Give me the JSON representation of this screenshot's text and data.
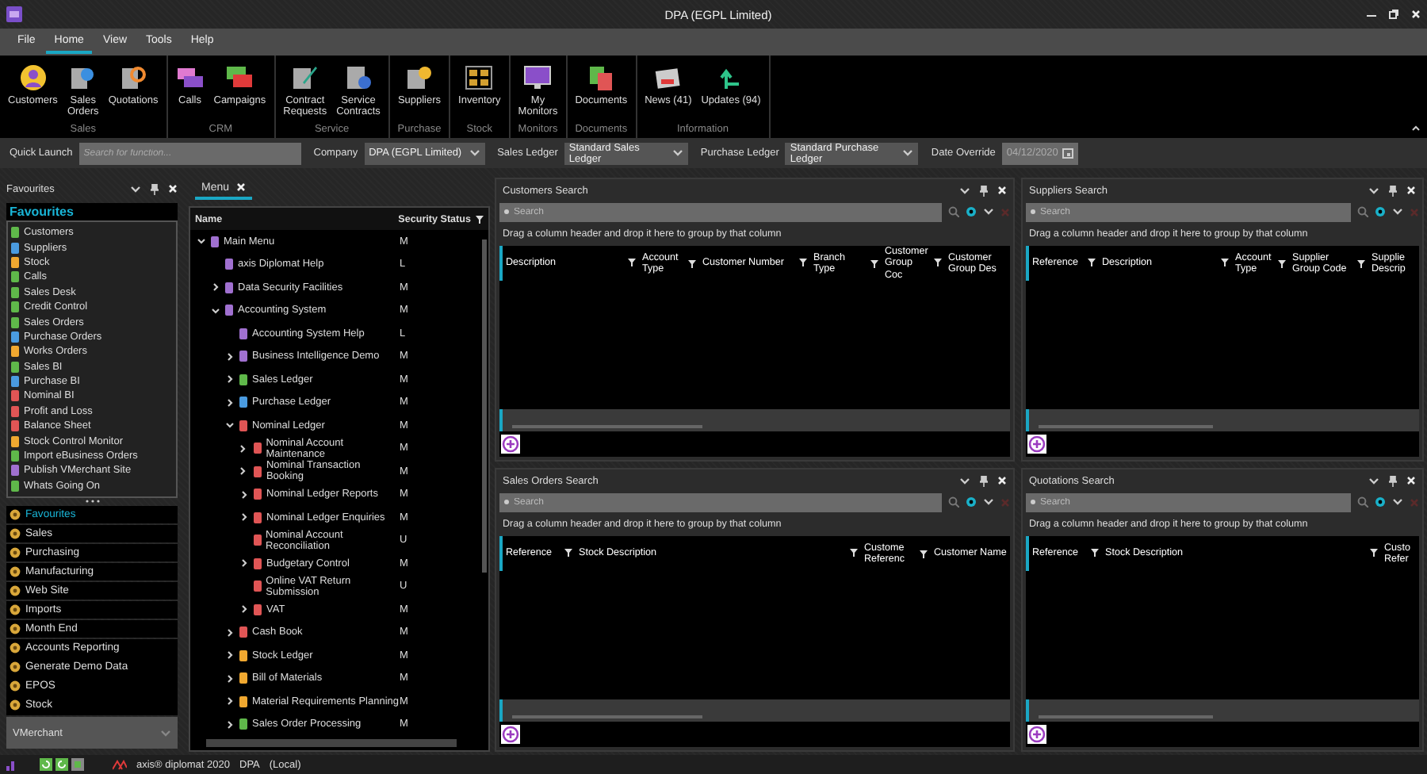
{
  "window": {
    "title": "DPA (EGPL Limited)"
  },
  "menu_bar": [
    {
      "label": "File",
      "selected": false
    },
    {
      "label": "Home",
      "selected": true
    },
    {
      "label": "View",
      "selected": false
    },
    {
      "label": "Tools",
      "selected": false
    },
    {
      "label": "Help",
      "selected": false
    }
  ],
  "ribbon": [
    {
      "label": "Sales",
      "buttons": [
        {
          "lines": [
            "Customers"
          ]
        },
        {
          "lines": [
            "Sales",
            "Orders"
          ]
        },
        {
          "lines": [
            "Quotations"
          ]
        }
      ]
    },
    {
      "label": "CRM",
      "buttons": [
        {
          "lines": [
            "Calls"
          ]
        },
        {
          "lines": [
            "Campaigns"
          ]
        }
      ]
    },
    {
      "label": "Service",
      "buttons": [
        {
          "lines": [
            "Contract",
            "Requests"
          ]
        },
        {
          "lines": [
            "Service",
            "Contracts"
          ]
        }
      ]
    },
    {
      "label": "Purchase",
      "buttons": [
        {
          "lines": [
            "Suppliers"
          ]
        }
      ]
    },
    {
      "label": "Stock",
      "buttons": [
        {
          "lines": [
            "Inventory"
          ]
        }
      ]
    },
    {
      "label": "Monitors",
      "buttons": [
        {
          "lines": [
            "My",
            "Monitors"
          ]
        }
      ]
    },
    {
      "label": "Documents",
      "buttons": [
        {
          "lines": [
            "Documents"
          ]
        }
      ]
    },
    {
      "label": "Information",
      "buttons": [
        {
          "lines": [
            "News (41)"
          ]
        },
        {
          "lines": [
            "Updates (94)"
          ]
        }
      ]
    }
  ],
  "quick_launch": {
    "label": "Quick Launch",
    "placeholder": "Search for function...",
    "selectors": [
      {
        "label": "Company",
        "value": "DPA (EGPL Limited)"
      },
      {
        "label": "Sales Ledger",
        "value": "Standard Sales Ledger"
      },
      {
        "label": "Purchase Ledger",
        "value": "Standard Purchase Ledger"
      }
    ],
    "date": {
      "label": "Date Override",
      "value": "04/12/2020",
      "disabled": true
    }
  },
  "favourites": {
    "title": "Favourites",
    "heading": "Favourites",
    "items": [
      {
        "label": "Customers",
        "color": "#5fb84a"
      },
      {
        "label": "Suppliers",
        "color": "#4a9be0"
      },
      {
        "label": "Stock",
        "color": "#f0a830"
      },
      {
        "label": "Calls",
        "color": "#5fb84a"
      },
      {
        "label": "Sales Desk",
        "color": "#5fb84a"
      },
      {
        "label": "Credit Control",
        "color": "#5fb84a"
      },
      {
        "label": "Sales Orders",
        "color": "#5fb84a"
      },
      {
        "label": "Purchase Orders",
        "color": "#4a9be0"
      },
      {
        "label": "Works Orders",
        "color": "#f0a830"
      },
      {
        "label": "Sales BI",
        "color": "#5fb84a"
      },
      {
        "label": "Purchase BI",
        "color": "#4a9be0"
      },
      {
        "label": "Nominal BI",
        "color": "#e05555"
      },
      {
        "label": "Profit and Loss",
        "color": "#e05555"
      },
      {
        "label": "Balance Sheet",
        "color": "#e05555"
      },
      {
        "label": "Stock Control Monitor",
        "color": "#f0a830"
      },
      {
        "label": "Import eBusiness Orders",
        "color": "#5fb84a"
      },
      {
        "label": "Publish VMerchant Site",
        "color": "#a070d0"
      },
      {
        "label": "Whats Going On",
        "color": "#5fb84a"
      }
    ],
    "groups": [
      {
        "label": "Favourites",
        "selected": true
      },
      {
        "label": "Sales",
        "selected": false
      },
      {
        "label": "Purchasing",
        "selected": false
      },
      {
        "label": "Manufacturing",
        "selected": false
      },
      {
        "label": "Web Site",
        "selected": false
      },
      {
        "label": "Imports",
        "selected": false
      },
      {
        "label": "Month End",
        "selected": false
      },
      {
        "label": "Accounts Reporting",
        "selected": false
      },
      {
        "label": "Generate Demo Data",
        "selected": false
      },
      {
        "label": "EPOS",
        "selected": false
      },
      {
        "label": "Stock",
        "selected": false
      }
    ],
    "collapsed_group": "VMerchant"
  },
  "menu": {
    "tab": "Menu",
    "columns": [
      "Name",
      "Security Status"
    ],
    "tree": [
      {
        "label": "Main Menu",
        "status": "M",
        "kind": "folder",
        "expanded": true,
        "color": "#a070d0",
        "children": [
          {
            "label": "axis Diplomat Help",
            "status": "L",
            "kind": "leaf",
            "color": "#a070d0"
          },
          {
            "label": "Data Security Facilities",
            "status": "M",
            "kind": "folder",
            "expanded": false,
            "color": "#a070d0"
          },
          {
            "label": "Accounting System",
            "status": "M",
            "kind": "folder",
            "expanded": true,
            "color": "#a070d0",
            "children": [
              {
                "label": "Accounting System Help",
                "status": "L",
                "kind": "leaf",
                "color": "#a070d0"
              },
              {
                "label": "Business Intelligence Demo",
                "status": "M",
                "kind": "folder",
                "expanded": false,
                "color": "#a070d0"
              },
              {
                "label": "Sales Ledger",
                "status": "M",
                "kind": "folder",
                "expanded": false,
                "color": "#5fb84a"
              },
              {
                "label": "Purchase Ledger",
                "status": "M",
                "kind": "folder",
                "expanded": false,
                "color": "#4a9be0"
              },
              {
                "label": "Nominal Ledger",
                "status": "M",
                "kind": "folder",
                "expanded": true,
                "color": "#e05555",
                "children": [
                  {
                    "label": "Nominal Account Maintenance",
                    "status": "M",
                    "kind": "folder",
                    "expanded": false,
                    "color": "#e05555"
                  },
                  {
                    "label": "Nominal Transaction Booking",
                    "status": "M",
                    "kind": "folder",
                    "expanded": false,
                    "color": "#e05555"
                  },
                  {
                    "label": "Nominal Ledger Reports",
                    "status": "M",
                    "kind": "folder",
                    "expanded": false,
                    "color": "#e05555"
                  },
                  {
                    "label": "Nominal Ledger Enquiries",
                    "status": "M",
                    "kind": "folder",
                    "expanded": false,
                    "color": "#e05555"
                  },
                  {
                    "label": "Nominal Account Reconciliation",
                    "status": "U",
                    "kind": "leaf",
                    "color": "#e05555"
                  },
                  {
                    "label": "Budgetary Control",
                    "status": "M",
                    "kind": "folder",
                    "expanded": false,
                    "color": "#e05555"
                  },
                  {
                    "label": "Online VAT Return Submission",
                    "status": "U",
                    "kind": "leaf",
                    "color": "#e05555"
                  },
                  {
                    "label": "VAT",
                    "status": "M",
                    "kind": "folder",
                    "expanded": false,
                    "color": "#e05555"
                  }
                ]
              },
              {
                "label": "Cash Book",
                "status": "M",
                "kind": "folder",
                "expanded": false,
                "color": "#e05555"
              },
              {
                "label": "Stock Ledger",
                "status": "M",
                "kind": "folder",
                "expanded": false,
                "color": "#f0a830"
              },
              {
                "label": "Bill of Materials",
                "status": "M",
                "kind": "folder",
                "expanded": false,
                "color": "#f0a830"
              },
              {
                "label": "Material Requirements Planning",
                "status": "M",
                "kind": "folder",
                "expanded": false,
                "color": "#f0a830"
              },
              {
                "label": "Sales Order Processing",
                "status": "M",
                "kind": "folder",
                "expanded": false,
                "color": "#5fb84a"
              }
            ]
          }
        ]
      }
    ]
  },
  "grids": [
    {
      "title": "Customers Search",
      "placeholder": "Search",
      "group_hint": "Drag a column header and drop it here to group by that column",
      "columns": [
        "Description",
        "Account Type",
        "Customer Number",
        "Branch Type",
        "Customer Group Coc",
        "Customer Group Des"
      ]
    },
    {
      "title": "Suppliers Search",
      "placeholder": "Search",
      "group_hint": "Drag a column header and drop it here to group by that column",
      "columns": [
        "Reference",
        "Description",
        "Account Type",
        "Supplier Group Code",
        "Supplie Descrip"
      ]
    },
    {
      "title": "Sales Orders Search",
      "placeholder": "Search",
      "group_hint": "Drag a column header and drop it here to group by that column",
      "columns": [
        "Reference",
        "Stock Description",
        "Custome Referenc",
        "Customer Name"
      ]
    },
    {
      "title": "Quotations Search",
      "placeholder": "Search",
      "group_hint": "Drag a column header and drop it here to group by that column",
      "columns": [
        "Reference",
        "Stock Description",
        "Custo Refer"
      ]
    }
  ],
  "status_bar": {
    "product": "axis® diplomat 2020",
    "company": "DPA",
    "mode": "(Local)"
  }
}
